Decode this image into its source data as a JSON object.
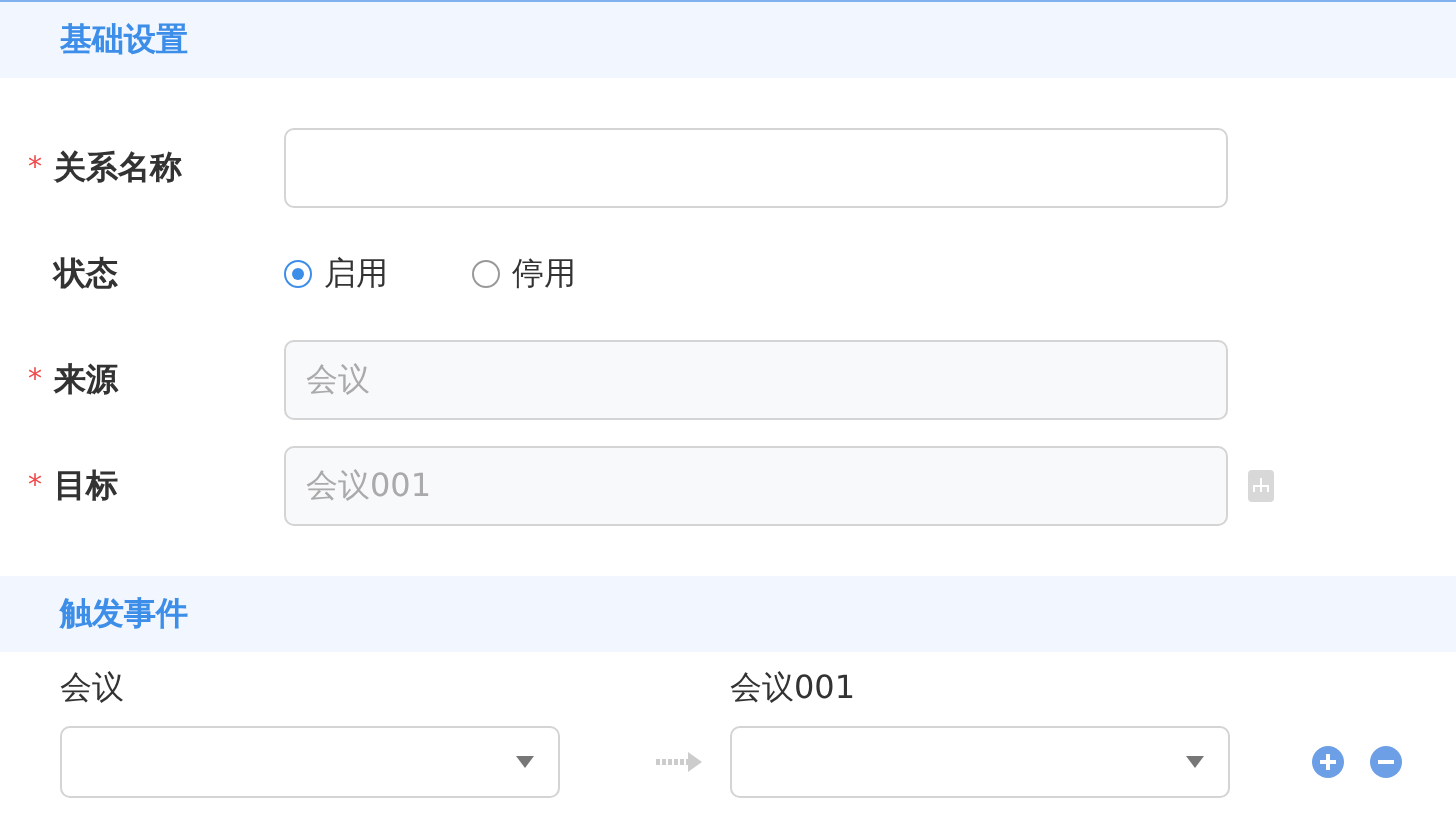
{
  "sections": [
    {
      "title": "基础设置",
      "kind": "basic"
    },
    {
      "title": "触发事件",
      "kind": "trigger"
    }
  ],
  "fields": [
    {
      "kind": "input",
      "label": "关系名称",
      "marker": "*"
    },
    {
      "kind": "radio",
      "label": "状态",
      "options": [
        {
          "label": "启用",
          "selected": true
        },
        {
          "label": "停用",
          "selected": false
        }
      ]
    },
    {
      "kind": "input",
      "label": "来源",
      "marker": "*",
      "value": "会议",
      "disabled": true
    },
    {
      "kind": "input",
      "label": "目标",
      "marker": "*",
      "value": "会议001",
      "disabled": true,
      "side_icon": true
    }
  ],
  "trigger": {
    "source_label": "会议",
    "target_label": "会议001"
  }
}
